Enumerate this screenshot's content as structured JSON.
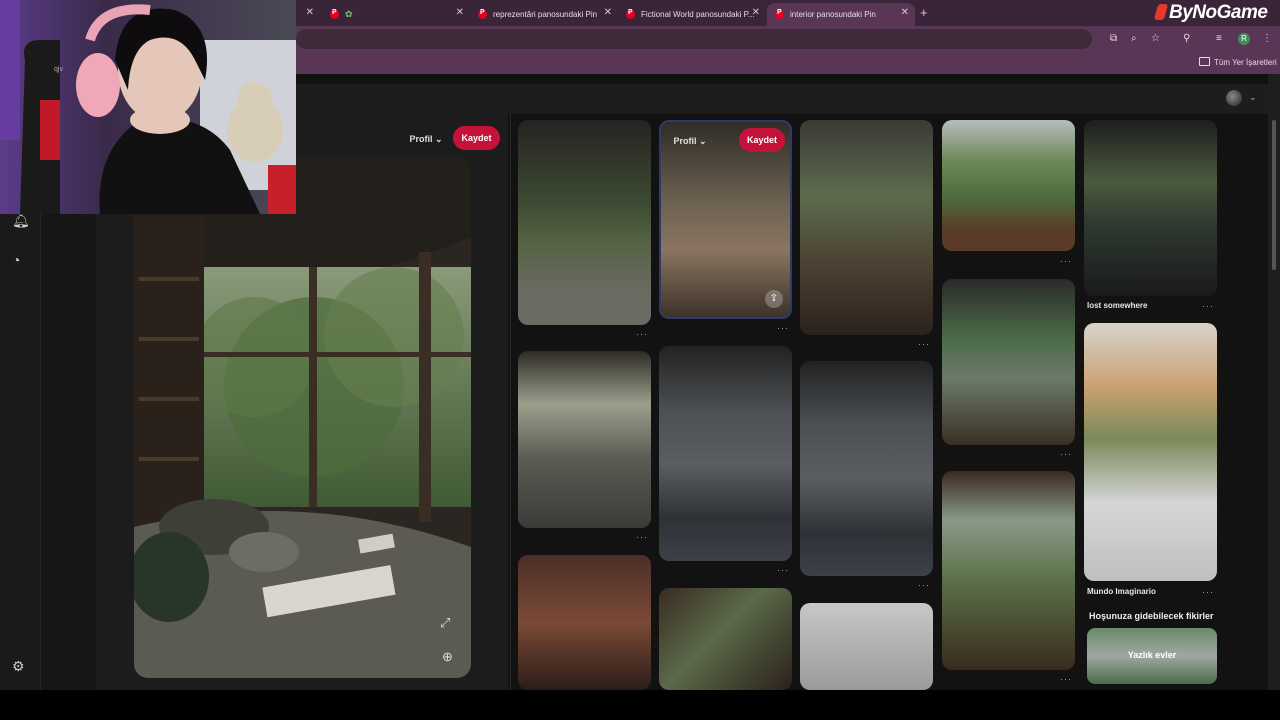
{
  "browser": {
    "tabs": [
      {
        "label": "",
        "partial": true
      },
      {
        "label": "",
        "icons": "pinterest-plant"
      },
      {
        "label": "reprezentări panosundaki Pin"
      },
      {
        "label": "Fictional World panosundaki P..."
      },
      {
        "label": "interior panosundaki Pin",
        "active": true
      }
    ],
    "new_tab": "+",
    "bookmarks_label": "Tüm Yer İşaretleri",
    "profile_initial": "R"
  },
  "overlay_logo": "ByNoGame",
  "pin": {
    "profile_label": "Profil",
    "save_label": "Kaydet"
  },
  "hover_tile": {
    "profile_label": "Profil",
    "save_label": "Kaydet"
  },
  "feed": {
    "captions": {
      "lost_somewhere": "lost somewhere",
      "mundo": "Mundo Imaginario",
      "suggestions": "Hoşunuza gidebilecek fikirler",
      "yazlik": "Yazlık evler"
    },
    "more": "···"
  },
  "webcam_overlay_text": "qjv",
  "colors": {
    "pinterest_red": "#c4123a",
    "tab_bg": "#3a2538",
    "toolbar_bg": "#5a3656",
    "page_bg": "#121212"
  }
}
